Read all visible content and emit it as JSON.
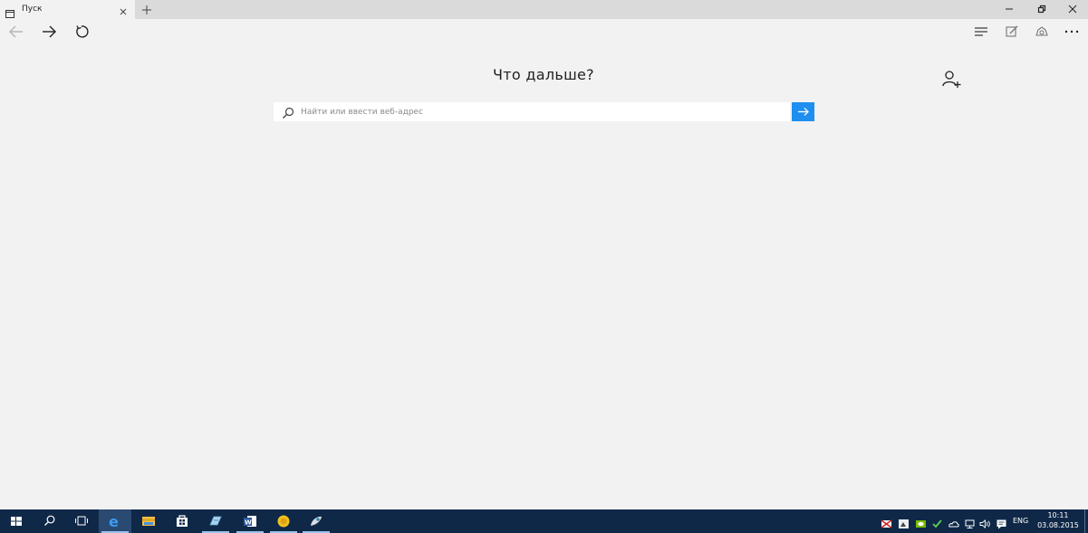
{
  "tab": {
    "title": "Пуск",
    "icon": "tab-page-icon"
  },
  "window_controls": [
    "minimize-icon",
    "restore-icon",
    "close-icon"
  ],
  "nav": {
    "left_icons": [
      "back-arrow-icon",
      "forward-arrow-icon",
      "refresh-icon"
    ],
    "right_icons": [
      "hub-icon",
      "web-note-icon",
      "share-icon",
      "more-icon"
    ]
  },
  "main": {
    "headline": "Что дальше?",
    "search_placeholder": "Найти или ввести веб-адрес",
    "search_value": ""
  },
  "taskbar": {
    "items": [
      "start-icon",
      "search-icon",
      "task-view-icon",
      "edge-icon",
      "file-explorer-icon",
      "store-icon",
      "app-icon",
      "word-icon",
      "app-icon",
      "app-icon"
    ],
    "tray_lang": "ENG",
    "time": "10:11",
    "date": "03.08.2015"
  },
  "colors": {
    "accent": "#1e8ff0",
    "taskbar": "#102848",
    "page_bg": "#f2f2f2",
    "tabbar_bg": "#dadada"
  }
}
